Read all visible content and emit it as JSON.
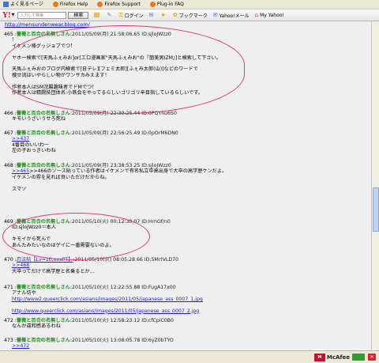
{
  "bookmarks": [
    {
      "label": "よく見るページ",
      "icon": "blue"
    },
    {
      "label": "Firefox Help",
      "icon": "orange"
    },
    {
      "label": "Firefox Support",
      "icon": "orange"
    },
    {
      "label": "Plug-in FAQ",
      "icon": "orange"
    }
  ],
  "toolbar": {
    "logo": "Y!",
    "search_placeholder": "入力して検索",
    "search_button": "検索",
    "tools": [
      {
        "label": "",
        "icon": "folder-icon"
      },
      {
        "label": "",
        "icon": "pencil-icon"
      },
      {
        "label": "ログイン",
        "icon": "key-icon"
      },
      {
        "label": "",
        "icon": "mail-icon"
      },
      {
        "label": "",
        "icon": "star-icon"
      },
      {
        "label": "ブックマーク",
        "icon": "bookmark-icon"
      },
      {
        "label": "Yahoo!メール",
        "icon": "mail-icon"
      },
      {
        "label": "My Yahoo!",
        "icon": "home-icon"
      }
    ]
  },
  "top_url": "http://mensundenwear.blog.com/",
  "posts": [
    {
      "num": "465 :",
      "name": "薔薇と百合の名無しさん",
      "meta": ":2011/05/09(月) 21:58:06.65 ID:sjloJWzz0",
      "lines": [
        "！",
        "イケメン様グッジョブでつ！",
        "",
        "ヤホー検索で[天馬ふぇみお]or[エロ漫画家\"天馬ふぇみお\"の『箇美男IZM』]と検索して下さい。",
        "",
        "天馬ふぇみおのブログ内検索で[日テレ][フェミ太郎][ふぇみ太郎(山)]などのワードで",
        "捜せ流はいやらしい物がワンサカみえます！",
        "",
        "作者本人はSM浣腸趣味者でドMでつ！",
        "作者本人は精闘技団体名:小鉄会をやってるらしいゴリゴリ辛目指しているらしいです。"
      ]
    },
    {
      "num": "466 :",
      "name": "薔薇と百合の名無しさん",
      "meta": ":2011/05/09(月) 22:30:25.44 ID:0PQYnu6S0",
      "lines": [
        "キモいうざいうせろ死ね"
      ]
    },
    {
      "num": "467 :",
      "name": "薔薇と百合の名無しさん",
      "meta": ":2011/05/09(月) 22:56:25.49 ID:0pOrM6DN0",
      "anchor": ">>437",
      "lines": [
        "4番目のいいわー",
        "左の子おっきいわね"
      ]
    },
    {
      "num": "468 :",
      "name": "薔薇と百合の名無しさん",
      "meta": ":2011/05/09(月) 23:38:53.25 ID:sjloJWzz0",
      "anchor": ">>465",
      "anchor_suffix": ">>466のソース貼っている作者はイケメンで有名私立中高出身で大卒の高学歴ケンだよ。",
      "lines": [
        "イケメンの雰を見れば良いただけだからね。",
        "",
        "スマソ"
      ]
    },
    {
      "num": "469 :",
      "name": "薔薇と百合の名無しさん",
      "meta": ":2011/05/10(火) 00:12:30.07 ID:HrnGf/n0",
      "lines": [
        "ID:sjloJWzz0＝本人",
        "",
        "キモイから死んで",
        "あんたみたいなのはゲイに一番需要ないのよ。"
      ]
    },
    {
      "num": "470 :",
      "name": "忍法帖【Lv=10,xxxPT】",
      "meta": ":2011/05/10(火) 08:05:28.66 ID:5MrtVLD70",
      "anchor": ">>468",
      "lines": [
        "大卒ってだけで高学歴と名乗るとか…"
      ]
    },
    {
      "num": "471 :",
      "name": "薔薇と百合の名無しさん",
      "meta": ":2011/05/10(火) 12:22:55.88 ID:FugA17x00",
      "lines": [
        "アナル坊や"
      ],
      "links": [
        "http://www2.queerclick.com/asians/images/2011/05/japanese_ass_0007_1.jpg",
        "http://www.queerclick.com/asians/images/2011/05/japanese_ass_0007_2.jpg"
      ]
    },
    {
      "num": "472 :",
      "name": "薔薇と百合の名無しさん",
      "meta": ":2011/05/10(火) 12:58:23.12 ID:cfCpiC0B0",
      "lines": [
        "なんか違和感あるわね"
      ]
    },
    {
      "num": "473 :",
      "name": "薔薇と百合の名無しさん",
      "meta": ":2011/05/10(火) 13:08:05.78 ID:6yZ0bTYO",
      "anchor": ">>472",
      "lines": []
    }
  ],
  "status": {
    "mcafee_label": "McAfee"
  }
}
